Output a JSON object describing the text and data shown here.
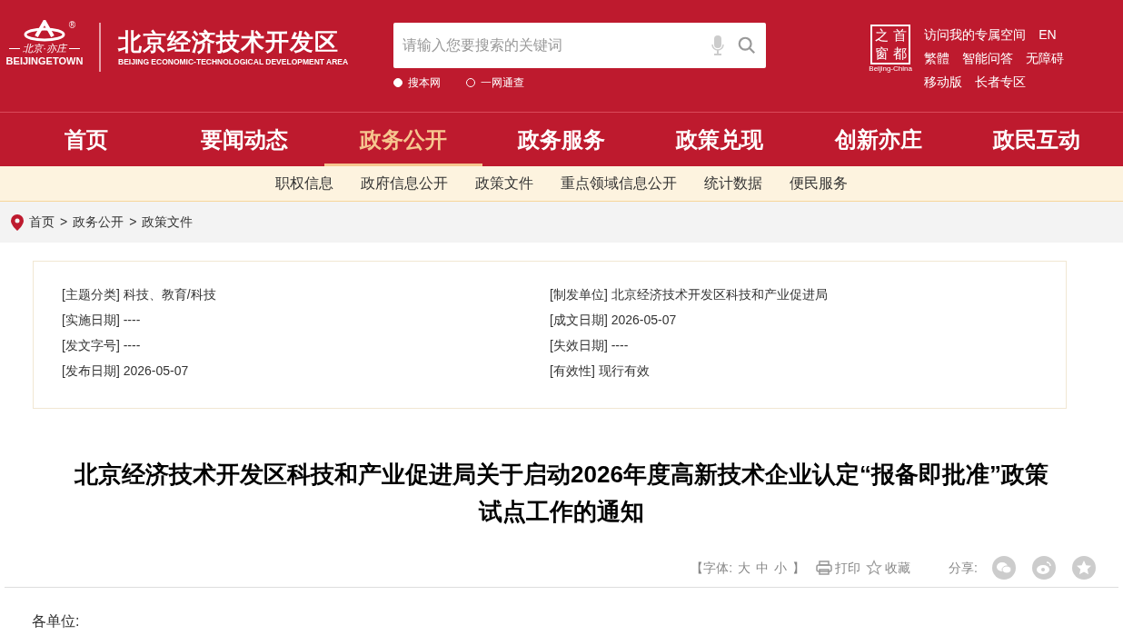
{
  "header": {
    "logo": {
      "mark": "®",
      "tagline": "北京·亦庄",
      "name": "BEIJINGETOWN"
    },
    "site_title": "北京经济技术开发区",
    "site_subtitle": "BEIJING ECONOMIC-TECHNOLOGICAL DEVELOPMENT AREA",
    "search": {
      "placeholder": "请输入您要搜索的关键词",
      "scopes": [
        {
          "label": "搜本网",
          "selected": true
        },
        {
          "label": "一网通查",
          "selected": false
        }
      ]
    },
    "capital_logo": {
      "chars": [
        "之",
        "首",
        "窗",
        "都"
      ],
      "caption": "Beijing-China"
    },
    "links": [
      [
        "访问我的专属空间",
        "EN"
      ],
      [
        "繁體",
        "智能问答",
        "无障碍"
      ],
      [
        "移动版",
        "长者专区"
      ]
    ]
  },
  "nav": [
    {
      "label": "首页",
      "selected": false
    },
    {
      "label": "要闻动态",
      "selected": false
    },
    {
      "label": "政务公开",
      "selected": true
    },
    {
      "label": "政务服务",
      "selected": false
    },
    {
      "label": "政策兑现",
      "selected": false
    },
    {
      "label": "创新亦庄",
      "selected": false
    },
    {
      "label": "政民互动",
      "selected": false
    }
  ],
  "subnav": [
    "职权信息",
    "政府信息公开",
    "政策文件",
    "重点领域信息公开",
    "统计数据",
    "便民服务"
  ],
  "breadcrumb": [
    {
      "label": "首页"
    },
    {
      "separator": ">",
      "label": "政务公开"
    },
    {
      "separator": ">",
      "label": "政策文件"
    }
  ],
  "metadata": [
    "[主题分类] 科技、教育/科技",
    "[制发单位] 北京经济技术开发区科技和产业促进局",
    "[实施日期] ----",
    "[成文日期] 2026-05-07",
    "[发文字号] ----",
    "[失效日期] ----",
    "[发布日期] 2026-05-07",
    "[有效性] 现行有效"
  ],
  "article": {
    "title": "北京经济技术开发区科技和产业促进局关于启动2026年度高新技术企业认定“报备即批准”政策试点工作的通知",
    "tools": {
      "font_open": "【字体:",
      "sizes": [
        "大",
        "中",
        "小"
      ],
      "font_close": "】",
      "print": "打印",
      "favorite": "收藏",
      "share": "分享:"
    },
    "salutation": "各单位:"
  }
}
